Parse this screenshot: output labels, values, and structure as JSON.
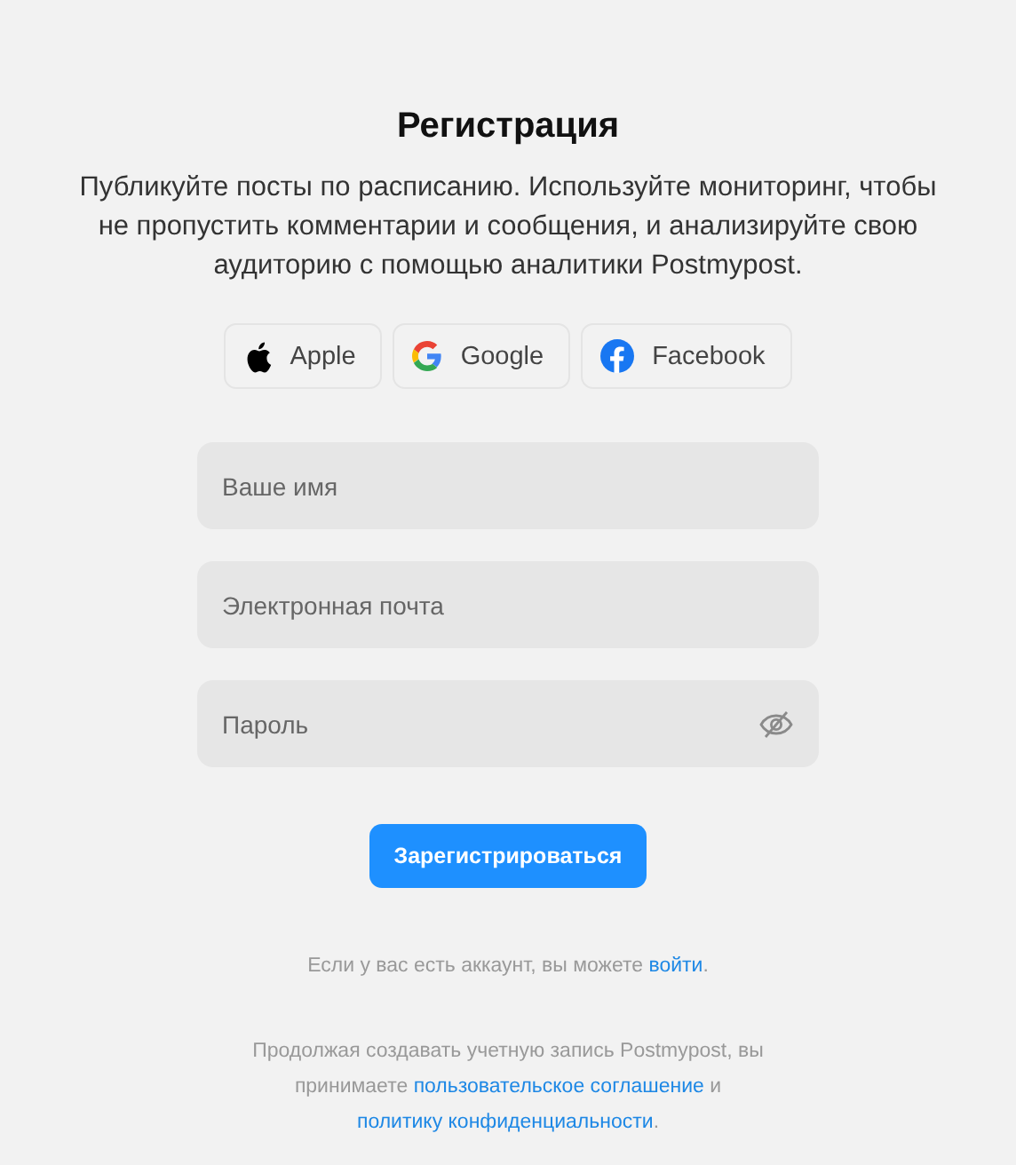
{
  "title": "Регистрация",
  "description": "Публикуйте посты по расписанию. Используйте мониторинг, чтобы не пропустить комментарии и сообщения, и анализируйте свою аудиторию с помощью аналитики Postmypost.",
  "social_buttons": [
    {
      "label": "Apple",
      "kind": "apple"
    },
    {
      "label": "Google",
      "kind": "google"
    },
    {
      "label": "Facebook",
      "kind": "facebook"
    }
  ],
  "fields": [
    {
      "placeholder": "Ваше имя",
      "kind": "text"
    },
    {
      "placeholder": "Электронная почта",
      "kind": "email"
    },
    {
      "placeholder": "Пароль",
      "kind": "password"
    }
  ],
  "submit": "Зарегистрироваться",
  "login_note": {
    "before": "Если у вас есть аккаунт, вы можете",
    "link": "войти",
    "after": "."
  },
  "terms": {
    "before": "Продолжая создавать учетную запись Postmypost, вы принимаете",
    "link_1": "пользовательское соглашение",
    "middle": "и",
    "link_2": "политику конфиденциальности",
    "after": "."
  }
}
